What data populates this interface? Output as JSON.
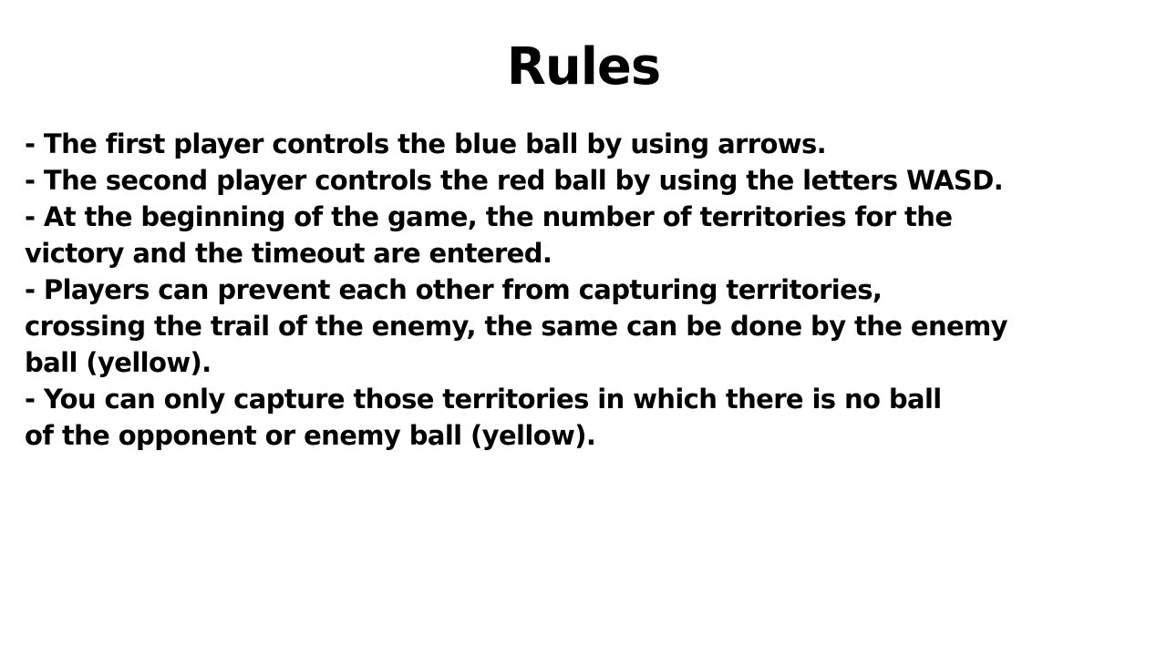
{
  "title": "Rules",
  "rules": {
    "lines": [
      "- The first player controls the blue ball by using arrows.",
      "- The second player controls the red ball by using the letters WASD.",
      "- At the beginning of the game, the number of territories for the",
      "victory and the timeout are entered.",
      "- Players can prevent each other from capturing territories,",
      "crossing the trail of the enemy, the same can be done by the enemy",
      "ball (yellow).",
      "- You can only capture those territories in which there is no ball",
      "of the opponent or enemy ball (yellow)."
    ]
  },
  "colors": {
    "background": "#ffffff",
    "text": "#000000"
  }
}
